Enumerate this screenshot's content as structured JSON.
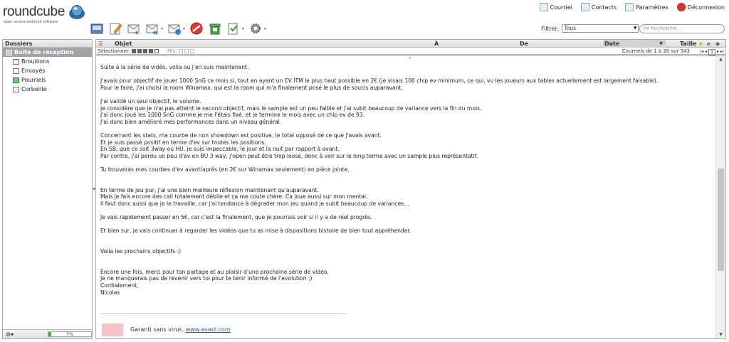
{
  "logo": {
    "text": "roundcube",
    "tagline": "open source webmail software"
  },
  "topnav": [
    {
      "label": "Courriel",
      "icon": "mail-icon"
    },
    {
      "label": "Contacts",
      "icon": "contacts-icon"
    },
    {
      "label": "Paramètres",
      "icon": "settings-icon"
    },
    {
      "label": "Déconnexion",
      "icon": "logout-icon"
    }
  ],
  "filter": {
    "label": "Filtrer:",
    "value": "Tous"
  },
  "search": {
    "placeholder": "Recherche..."
  },
  "sidebar": {
    "title": "Dossiers",
    "folders": [
      {
        "label": "Boîte de réception",
        "active": true
      },
      {
        "label": "Brouillons"
      },
      {
        "label": "Envoyés"
      },
      {
        "label": "Pourriels"
      },
      {
        "label": "Corbeille"
      }
    ],
    "quota": {
      "text": "7%",
      "percent": 7
    }
  },
  "messagelist": {
    "columns": {
      "subject": "Objet",
      "to": "À",
      "from": "De",
      "date": "Date",
      "size": "Taille"
    },
    "select_label": "Sélectionner:",
    "threads_label": "Fils:",
    "count": "Courriels de 1 à 20 sur 343",
    "page": "1"
  },
  "message": {
    "lines": [
      "Suite à la série de vidéo, voila ou j'en suis maintenant.",
      "",
      "J'avais pour objectif de jouer 1000 SnG ce mois si, tout en ayant un EV ITM le plus haut possible en 2€ (je visais 100 chip ev minimum, ce qui, vu les joueurs aux tables actuellement est largement faisable).",
      "Pour le faire, j'ai choisi la room Winamax, qui est la room qui m'a finalement posé le plus de soucis auparavant.",
      "",
      "J'ai validé un seul objectif, le volume.",
      "Je considère que je n'ai pas atteint le second objectif, mais le sample est un peu faible et j'ai subit beaucoup de variance vers la fin du mois.",
      "J'ai donc joué les 1000 SnG comme je me l'étais fixé, et je termine le mois avec un chip ev de 93.",
      "J'ai donc bien amélioré mes performances dans un niveau général.",
      "",
      "Concernant les stats, ma courbe de non showdown est positive, le total opposé de ce que j'avais avant.",
      "Et je suis passé positif en terme d'ev sur toutes les positions.",
      "En SB, que ce soit 3way ou HU, je suis impeccable, le jour et la nuit par rapport à avant.",
      "Par contre, j'ai perdu un peu d'ev en BU 3 way, j'open peut être trop loose, donc à voir sur le long terme avec un sample plus représentatif.",
      "",
      "Tu trouveras mes courbes d'ev avant/après (en 2€ sur Winamax seulement) en pièce jointe.",
      "",
      "",
      "En terme de jeu pur, j'ai une bien meilleure réflexion maintenant qu'auparavant.",
      "Mais je fais encore des call totalement débile et ça me coute chère. Ca joue aussi sur mon mental.",
      "Il faut donc aussi que je le travaille, car j'ai tendance à dégrader mon jeu quand je subit beaucoup de variances...",
      "",
      "Je vais rapidement passer en 5€, car c'est la finalement, que je pourrais voir si il y a de réel progrès.",
      "",
      "Et bien sur, je vais continuer à regarder les vidéos que tu as mise à dispositions histoire de bien tout appréhender.",
      "",
      "",
      "Voila les prochains objectifs :)",
      "",
      "",
      "Encore une fois, merci pour ton partage et au plaisir d'une prochaine série de vidéo.",
      "Je ne manquerais pas de revenir vers toi pour te tenir informé de l'evolution :)",
      "Cordialement,",
      "Nicolas"
    ],
    "avast_text": "Garanti sans virus.",
    "avast_link": "www.avast.com"
  }
}
